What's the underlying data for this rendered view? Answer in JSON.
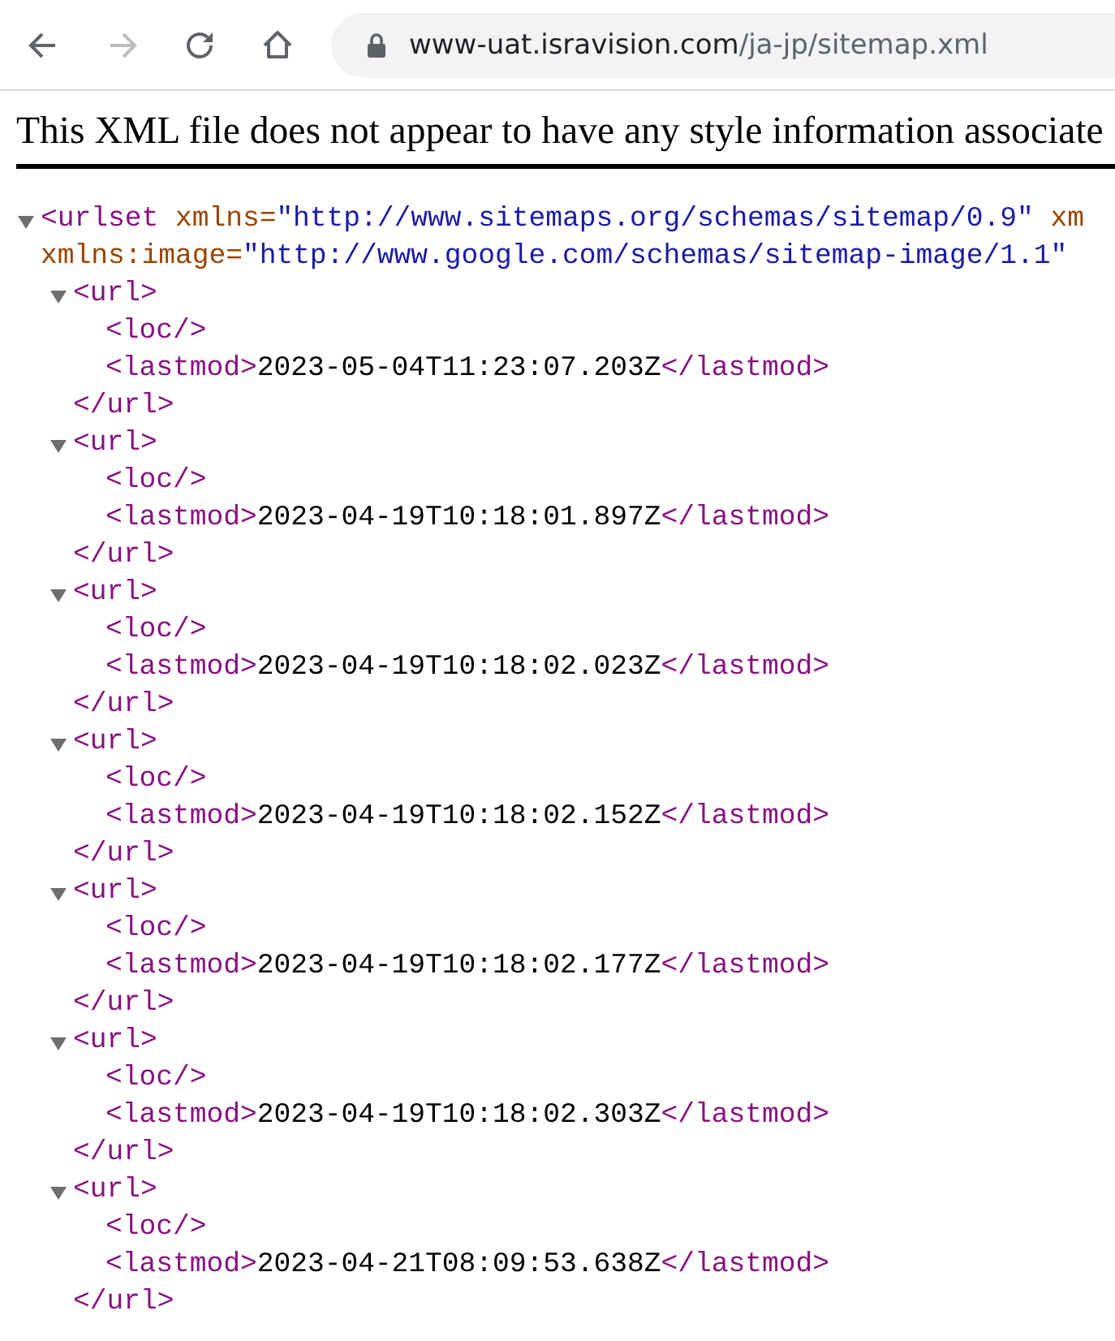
{
  "browser": {
    "back_enabled": true,
    "forward_enabled": false,
    "url_host": "www-uat.isravision.com",
    "url_path": "/ja-jp/sitemap.xml"
  },
  "notice": "This XML file does not appear to have any style information associate",
  "xml": {
    "expanded": true,
    "open": [
      [
        {
          "kind": "tag",
          "text": "<urlset"
        },
        {
          "kind": "attr_name",
          "text": " xmlns="
        },
        {
          "kind": "attr_value",
          "text": "\"http://www.sitemaps.org/schemas/sitemap/0.9\""
        },
        {
          "kind": "attr_name",
          "text": " xm"
        }
      ],
      [
        {
          "kind": "attr_name",
          "text": "xmlns:image="
        },
        {
          "kind": "attr_value",
          "text": "\"http://www.google.com/schemas/sitemap-image/1.1\""
        }
      ]
    ],
    "children": [
      {
        "expanded": true,
        "open": [
          [
            {
              "kind": "tag",
              "text": "<url>"
            }
          ]
        ],
        "children": [
          {
            "line": [
              {
                "kind": "tag",
                "text": "<loc/>"
              }
            ]
          },
          {
            "line": [
              {
                "kind": "tag",
                "text": "<lastmod>"
              },
              {
                "kind": "text",
                "text": "2023-05-04T11:23:07.203Z"
              },
              {
                "kind": "tag",
                "text": "</lastmod>"
              }
            ]
          }
        ],
        "close": [
          {
            "kind": "tag",
            "text": "</url>"
          }
        ]
      },
      {
        "expanded": true,
        "open": [
          [
            {
              "kind": "tag",
              "text": "<url>"
            }
          ]
        ],
        "children": [
          {
            "line": [
              {
                "kind": "tag",
                "text": "<loc/>"
              }
            ]
          },
          {
            "line": [
              {
                "kind": "tag",
                "text": "<lastmod>"
              },
              {
                "kind": "text",
                "text": "2023-04-19T10:18:01.897Z"
              },
              {
                "kind": "tag",
                "text": "</lastmod>"
              }
            ]
          }
        ],
        "close": [
          {
            "kind": "tag",
            "text": "</url>"
          }
        ]
      },
      {
        "expanded": true,
        "open": [
          [
            {
              "kind": "tag",
              "text": "<url>"
            }
          ]
        ],
        "children": [
          {
            "line": [
              {
                "kind": "tag",
                "text": "<loc/>"
              }
            ]
          },
          {
            "line": [
              {
                "kind": "tag",
                "text": "<lastmod>"
              },
              {
                "kind": "text",
                "text": "2023-04-19T10:18:02.023Z"
              },
              {
                "kind": "tag",
                "text": "</lastmod>"
              }
            ]
          }
        ],
        "close": [
          {
            "kind": "tag",
            "text": "</url>"
          }
        ]
      },
      {
        "expanded": true,
        "open": [
          [
            {
              "kind": "tag",
              "text": "<url>"
            }
          ]
        ],
        "children": [
          {
            "line": [
              {
                "kind": "tag",
                "text": "<loc/>"
              }
            ]
          },
          {
            "line": [
              {
                "kind": "tag",
                "text": "<lastmod>"
              },
              {
                "kind": "text",
                "text": "2023-04-19T10:18:02.152Z"
              },
              {
                "kind": "tag",
                "text": "</lastmod>"
              }
            ]
          }
        ],
        "close": [
          {
            "kind": "tag",
            "text": "</url>"
          }
        ]
      },
      {
        "expanded": true,
        "open": [
          [
            {
              "kind": "tag",
              "text": "<url>"
            }
          ]
        ],
        "children": [
          {
            "line": [
              {
                "kind": "tag",
                "text": "<loc/>"
              }
            ]
          },
          {
            "line": [
              {
                "kind": "tag",
                "text": "<lastmod>"
              },
              {
                "kind": "text",
                "text": "2023-04-19T10:18:02.177Z"
              },
              {
                "kind": "tag",
                "text": "</lastmod>"
              }
            ]
          }
        ],
        "close": [
          {
            "kind": "tag",
            "text": "</url>"
          }
        ]
      },
      {
        "expanded": true,
        "open": [
          [
            {
              "kind": "tag",
              "text": "<url>"
            }
          ]
        ],
        "children": [
          {
            "line": [
              {
                "kind": "tag",
                "text": "<loc/>"
              }
            ]
          },
          {
            "line": [
              {
                "kind": "tag",
                "text": "<lastmod>"
              },
              {
                "kind": "text",
                "text": "2023-04-19T10:18:02.303Z"
              },
              {
                "kind": "tag",
                "text": "</lastmod>"
              }
            ]
          }
        ],
        "close": [
          {
            "kind": "tag",
            "text": "</url>"
          }
        ]
      },
      {
        "expanded": true,
        "open": [
          [
            {
              "kind": "tag",
              "text": "<url>"
            }
          ]
        ],
        "children": [
          {
            "line": [
              {
                "kind": "tag",
                "text": "<loc/>"
              }
            ]
          },
          {
            "line": [
              {
                "kind": "tag",
                "text": "<lastmod>"
              },
              {
                "kind": "text",
                "text": "2023-04-21T08:09:53.638Z"
              },
              {
                "kind": "tag",
                "text": "</lastmod>"
              }
            ]
          }
        ],
        "close": [
          {
            "kind": "tag",
            "text": "</url>"
          }
        ]
      }
    ]
  }
}
